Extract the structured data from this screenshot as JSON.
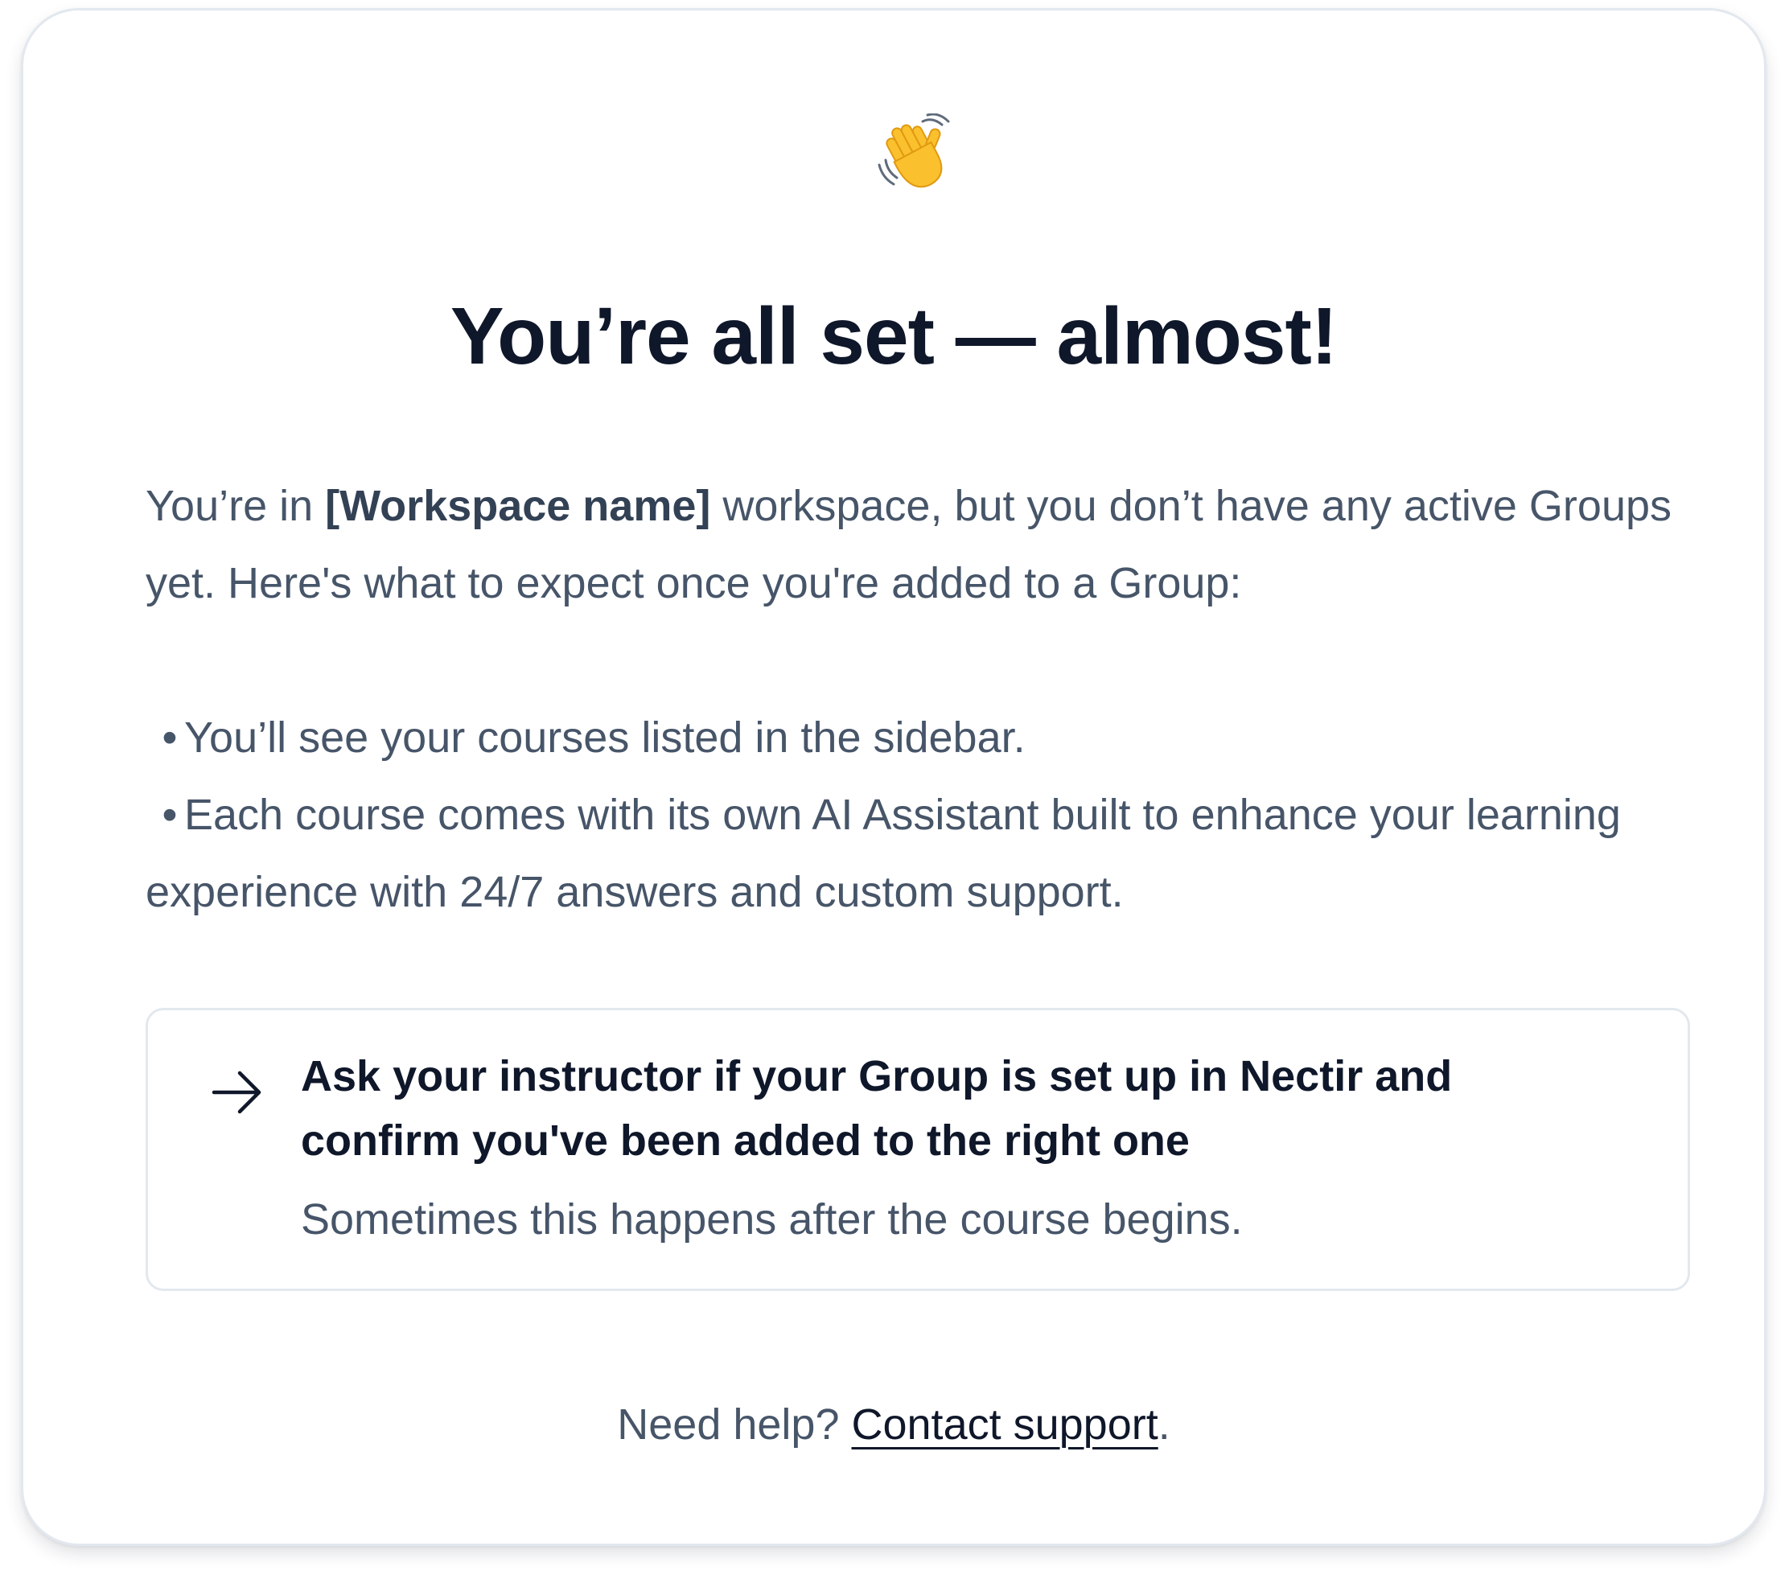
{
  "header": {
    "icon": "waving-hand-icon",
    "title": "You’re all set — almost!"
  },
  "intro": {
    "prefix": "You’re in ",
    "workspace_name": "[Workspace name]",
    "suffix": " workspace, but you don’t have any active Groups yet. Here's what to expect once you're added to a Group:"
  },
  "bullets": [
    "You’ll see your courses listed in the sidebar.",
    "Each course comes with its own AI Assistant built to enhance your learning experience with 24/7 answers and custom support."
  ],
  "bullet_glyph": "•",
  "action": {
    "icon": "arrow-right-icon",
    "title": "Ask your instructor if your Group is set up in Nectir and confirm you've been added to the right one",
    "subtitle": "Sometimes this happens after the course begins."
  },
  "help": {
    "prefix": "Need help? ",
    "link_label": "Contact support",
    "suffix": "."
  },
  "colors": {
    "heading": "#0f172a",
    "body_text": "#475569",
    "border": "#e3e8ef",
    "emoji_yellow": "#fbc02d"
  }
}
